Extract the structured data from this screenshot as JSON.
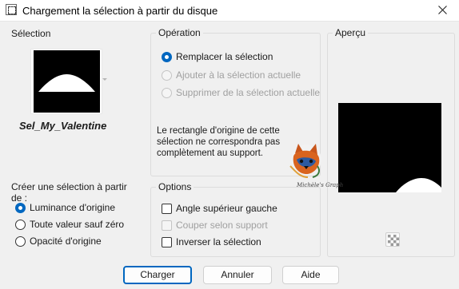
{
  "window": {
    "title": "Chargement la sélection à partir du disque",
    "close_icon": "close-icon"
  },
  "selection": {
    "group_title": "Sélection",
    "name": "Sel_My_Valentine"
  },
  "operation": {
    "group_title": "Opération",
    "options": [
      {
        "label": "Remplacer la sélection",
        "checked": true,
        "enabled": true
      },
      {
        "label": "Ajouter à la sélection actuelle",
        "checked": false,
        "enabled": false
      },
      {
        "label": "Supprimer de la sélection actuelle",
        "checked": false,
        "enabled": false
      }
    ],
    "message": "Le rectangle d'origine de cette sélection ne correspondra pas complètement au support."
  },
  "create": {
    "group_title": "Créer une sélection à partir de :",
    "options": [
      {
        "label": "Luminance d'origine",
        "checked": true
      },
      {
        "label": "Toute valeur sauf zéro",
        "checked": false
      },
      {
        "label": "Opacité d'origine",
        "checked": false
      }
    ]
  },
  "options": {
    "group_title": "Options",
    "checks": [
      {
        "label": "Angle supérieur gauche",
        "checked": false,
        "enabled": true
      },
      {
        "label": "Couper selon support",
        "checked": false,
        "enabled": false
      },
      {
        "label": "Inverser la sélection",
        "checked": false,
        "enabled": true
      }
    ]
  },
  "preview": {
    "group_title": "Aperçu",
    "toggle_icon": "checkerboard-icon"
  },
  "watermark": {
    "text": "Michèle's Graph"
  },
  "buttons": {
    "load": "Charger",
    "cancel": "Annuler",
    "help": "Aide"
  },
  "colors": {
    "accent": "#0067c0",
    "background": "#f0f0f0"
  }
}
